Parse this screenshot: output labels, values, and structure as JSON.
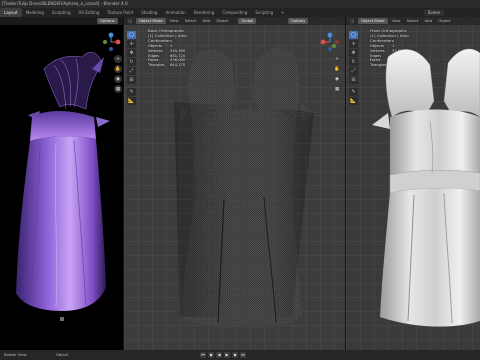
{
  "window": {
    "title": "[Trader/Tulip Dress/BLENDER/Aphrea_a_ucked] - Blender 4.0"
  },
  "workspaces": {
    "tabs": [
      "Layout",
      "Modeling",
      "Sculpting",
      "UV Editing",
      "Texture Paint",
      "Shading",
      "Animation",
      "Rendering",
      "Compositing",
      "Scripting",
      "+"
    ],
    "scene_label": "Scene"
  },
  "viewport_left": {
    "options_label": "Options"
  },
  "viewport_mid": {
    "header": {
      "mode": "Object Mode",
      "menus": [
        "View",
        "Select",
        "Add",
        "Object"
      ],
      "orientation": "Global",
      "options_label": "Options"
    },
    "overlay": {
      "view_name": "Back Orthographic",
      "collection": "(1) Collection | Amp",
      "units": "Centimeters"
    },
    "stats": [
      {
        "label": "Objects",
        "value": "1"
      },
      {
        "label": "Vertices",
        "value": "345,260"
      },
      {
        "label": "Edges",
        "value": "681,720"
      },
      {
        "label": "Faces",
        "value": "336,000"
      },
      {
        "label": "Triangles",
        "value": "644,170"
      }
    ]
  },
  "viewport_right": {
    "header": {
      "mode": "Object Mode",
      "menus": [
        "View",
        "Select",
        "Add",
        "Object"
      ]
    },
    "overlay": {
      "view_name": "Front Orthographic",
      "collection": "(1) Collection | Amp",
      "units": "Centimeters"
    },
    "stats": [
      {
        "label": "Objects",
        "value": "1"
      },
      {
        "label": "Vertices",
        "value": "37,600"
      },
      {
        "label": "Edges",
        "value": "75,400"
      },
      {
        "label": "Faces",
        "value": "37,120"
      },
      {
        "label": "Triangles",
        "value": "74,100"
      }
    ]
  },
  "statusbar": {
    "left": "Rotate View",
    "middle": "Object"
  },
  "colors": {
    "active_tab": "#3d3d3d",
    "tool_active": "#4a72b6",
    "dress_left": "#b58bef",
    "dress_right": "#d8d8d8"
  }
}
